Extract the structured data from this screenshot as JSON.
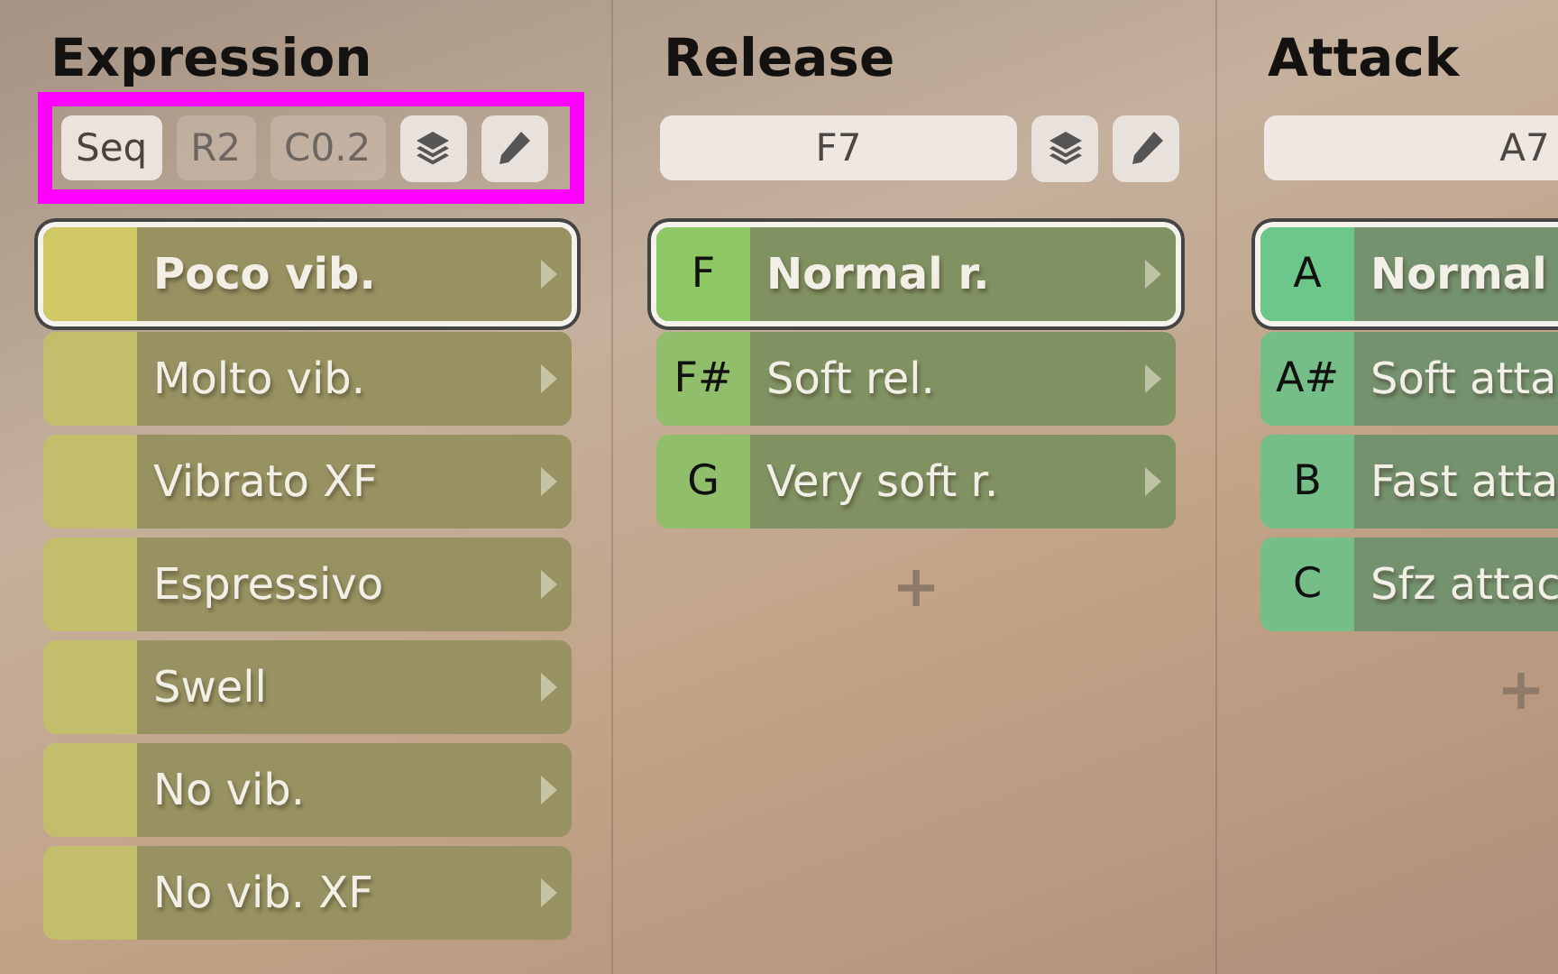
{
  "columns": [
    {
      "title": "Expression",
      "color": "#cfc865",
      "toolbar": {
        "highlighted": true,
        "items": [
          {
            "kind": "toggle",
            "label": "Seq",
            "selected": true
          },
          {
            "kind": "toggle",
            "label": "R2",
            "selected": false
          },
          {
            "kind": "toggle",
            "label": "C0.2",
            "selected": false
          },
          {
            "kind": "layers"
          },
          {
            "kind": "edit"
          }
        ]
      },
      "rows": [
        {
          "label": "Poco vib.",
          "selected": true
        },
        {
          "label": "Molto vib.",
          "selected": false
        },
        {
          "label": "Vibrato XF",
          "selected": false
        },
        {
          "label": "Espressivo",
          "selected": false
        },
        {
          "label": "Swell",
          "selected": false
        },
        {
          "label": "No vib.",
          "selected": false
        },
        {
          "label": "No vib. XF",
          "selected": false
        }
      ]
    },
    {
      "title": "Release",
      "color": "#8dc865",
      "toolbar": {
        "highlighted": false,
        "items": [
          {
            "kind": "field",
            "label": "F7"
          },
          {
            "kind": "layers"
          },
          {
            "kind": "edit"
          }
        ]
      },
      "rows": [
        {
          "key": "F",
          "label": "Normal r.",
          "selected": true
        },
        {
          "key": "F#",
          "label": "Soft rel.",
          "selected": false
        },
        {
          "key": "G",
          "label": "Very soft r.",
          "selected": false
        }
      ],
      "add": "+"
    },
    {
      "title": "Attack",
      "color": "#6cc88a",
      "toolbar": {
        "highlighted": false,
        "items": [
          {
            "kind": "field",
            "label": "A7"
          }
        ]
      },
      "rows": [
        {
          "key": "A",
          "label": "Normal",
          "selected": true
        },
        {
          "key": "A#",
          "label": "Soft atta",
          "selected": false
        },
        {
          "key": "B",
          "label": "Fast atta",
          "selected": false
        },
        {
          "key": "C",
          "label": "Sfz attac",
          "selected": false
        }
      ],
      "add": "+"
    }
  ]
}
